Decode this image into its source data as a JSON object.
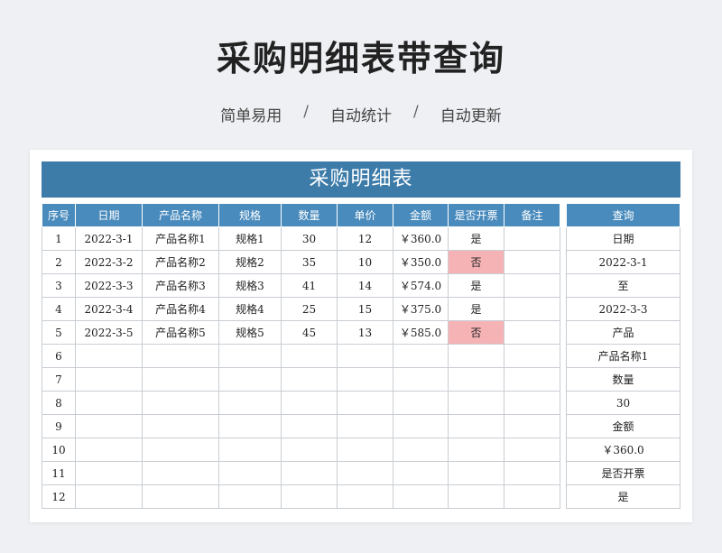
{
  "page": {
    "title": "采购明细表带查询",
    "taglines": [
      "简单易用",
      "自动统计",
      "自动更新"
    ],
    "separator": "/"
  },
  "sheet": {
    "title": "采购明细表",
    "headers": [
      "序号",
      "日期",
      "产品名称",
      "规格",
      "数量",
      "单价",
      "金额",
      "是否开票",
      "备注"
    ],
    "rows": [
      [
        "1",
        "2022-3-1",
        "产品名称1",
        "规格1",
        "30",
        "12",
        "￥360.0",
        "是",
        ""
      ],
      [
        "2",
        "2022-3-2",
        "产品名称2",
        "规格2",
        "35",
        "10",
        "￥350.0",
        "否",
        ""
      ],
      [
        "3",
        "2022-3-3",
        "产品名称3",
        "规格3",
        "41",
        "14",
        "￥574.0",
        "是",
        ""
      ],
      [
        "4",
        "2022-3-4",
        "产品名称4",
        "规格4",
        "25",
        "15",
        "￥375.0",
        "是",
        ""
      ],
      [
        "5",
        "2022-3-5",
        "产品名称5",
        "规格5",
        "45",
        "13",
        "￥585.0",
        "否",
        ""
      ],
      [
        "6",
        "",
        "",
        "",
        "",
        "",
        "",
        "",
        ""
      ],
      [
        "7",
        "",
        "",
        "",
        "",
        "",
        "",
        "",
        ""
      ],
      [
        "8",
        "",
        "",
        "",
        "",
        "",
        "",
        "",
        ""
      ],
      [
        "9",
        "",
        "",
        "",
        "",
        "",
        "",
        "",
        ""
      ],
      [
        "10",
        "",
        "",
        "",
        "",
        "",
        "",
        "",
        ""
      ],
      [
        "11",
        "",
        "",
        "",
        "",
        "",
        "",
        "",
        ""
      ],
      [
        "12",
        "",
        "",
        "",
        "",
        "",
        "",
        "",
        ""
      ]
    ],
    "highlight_color": "#f6b3b6",
    "header_color": "#4a8bbd",
    "banner_color": "#3d7ba9"
  },
  "query": {
    "header": "查询",
    "items": [
      "日期",
      "2022-3-1",
      "至",
      "2022-3-3",
      "产品",
      "产品名称1",
      "数量",
      "30",
      "金额",
      "￥360.0",
      "是否开票",
      "是"
    ]
  }
}
